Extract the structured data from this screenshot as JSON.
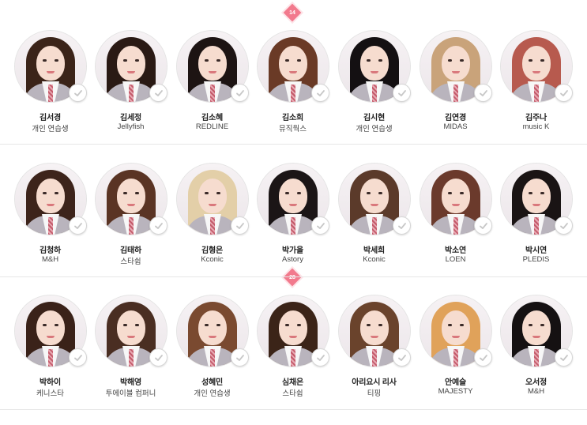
{
  "badges": [
    "14",
    "28"
  ],
  "colors": {
    "accent": "#f27a8d",
    "divider": "#e6e6e6",
    "check_icon": "#c8c8c8"
  },
  "rows": [
    {
      "trainees": [
        {
          "name": "김서경",
          "agency": "개인 연습생",
          "hair": "#3b2419"
        },
        {
          "name": "김세정",
          "agency": "Jellyfish",
          "hair": "#2a1a14"
        },
        {
          "name": "김소혜",
          "agency": "REDLINE",
          "hair": "#1d1413"
        },
        {
          "name": "김소희",
          "agency": "뮤직웍스",
          "hair": "#6a3a26"
        },
        {
          "name": "김시현",
          "agency": "개인 연습생",
          "hair": "#141012"
        },
        {
          "name": "김연경",
          "agency": "MIDAS",
          "hair": "#c9a37a"
        },
        {
          "name": "김주나",
          "agency": "music K",
          "hair": "#b75a4e"
        }
      ]
    },
    {
      "trainees": [
        {
          "name": "김청하",
          "agency": "M&H",
          "hair": "#3d241b"
        },
        {
          "name": "김태하",
          "agency": "스타쉽",
          "hair": "#5a3424"
        },
        {
          "name": "김형은",
          "agency": "Kconic",
          "hair": "#e3cfa8"
        },
        {
          "name": "박가을",
          "agency": "Astory",
          "hair": "#1b1516"
        },
        {
          "name": "박세희",
          "agency": "Kconic",
          "hair": "#5b3a2a"
        },
        {
          "name": "박소연",
          "agency": "LOEN",
          "hair": "#6b3a2c"
        },
        {
          "name": "박시연",
          "agency": "PLEDIS",
          "hair": "#1a1414"
        }
      ]
    },
    {
      "trainees": [
        {
          "name": "박하이",
          "agency": "케니스타",
          "hair": "#3a2219"
        },
        {
          "name": "박해영",
          "agency": "투에이블 컴퍼니",
          "hair": "#4a2e22"
        },
        {
          "name": "성혜민",
          "agency": "개인 연습생",
          "hair": "#7a4a30"
        },
        {
          "name": "심채은",
          "agency": "스타쉽",
          "hair": "#3b2418"
        },
        {
          "name": "아리요시 리사",
          "agency": "티핑",
          "hair": "#6a432c"
        },
        {
          "name": "안예슬",
          "agency": "MAJESTY",
          "hair": "#e0a25a"
        },
        {
          "name": "오서정",
          "agency": "M&H",
          "hair": "#151112"
        }
      ]
    }
  ]
}
